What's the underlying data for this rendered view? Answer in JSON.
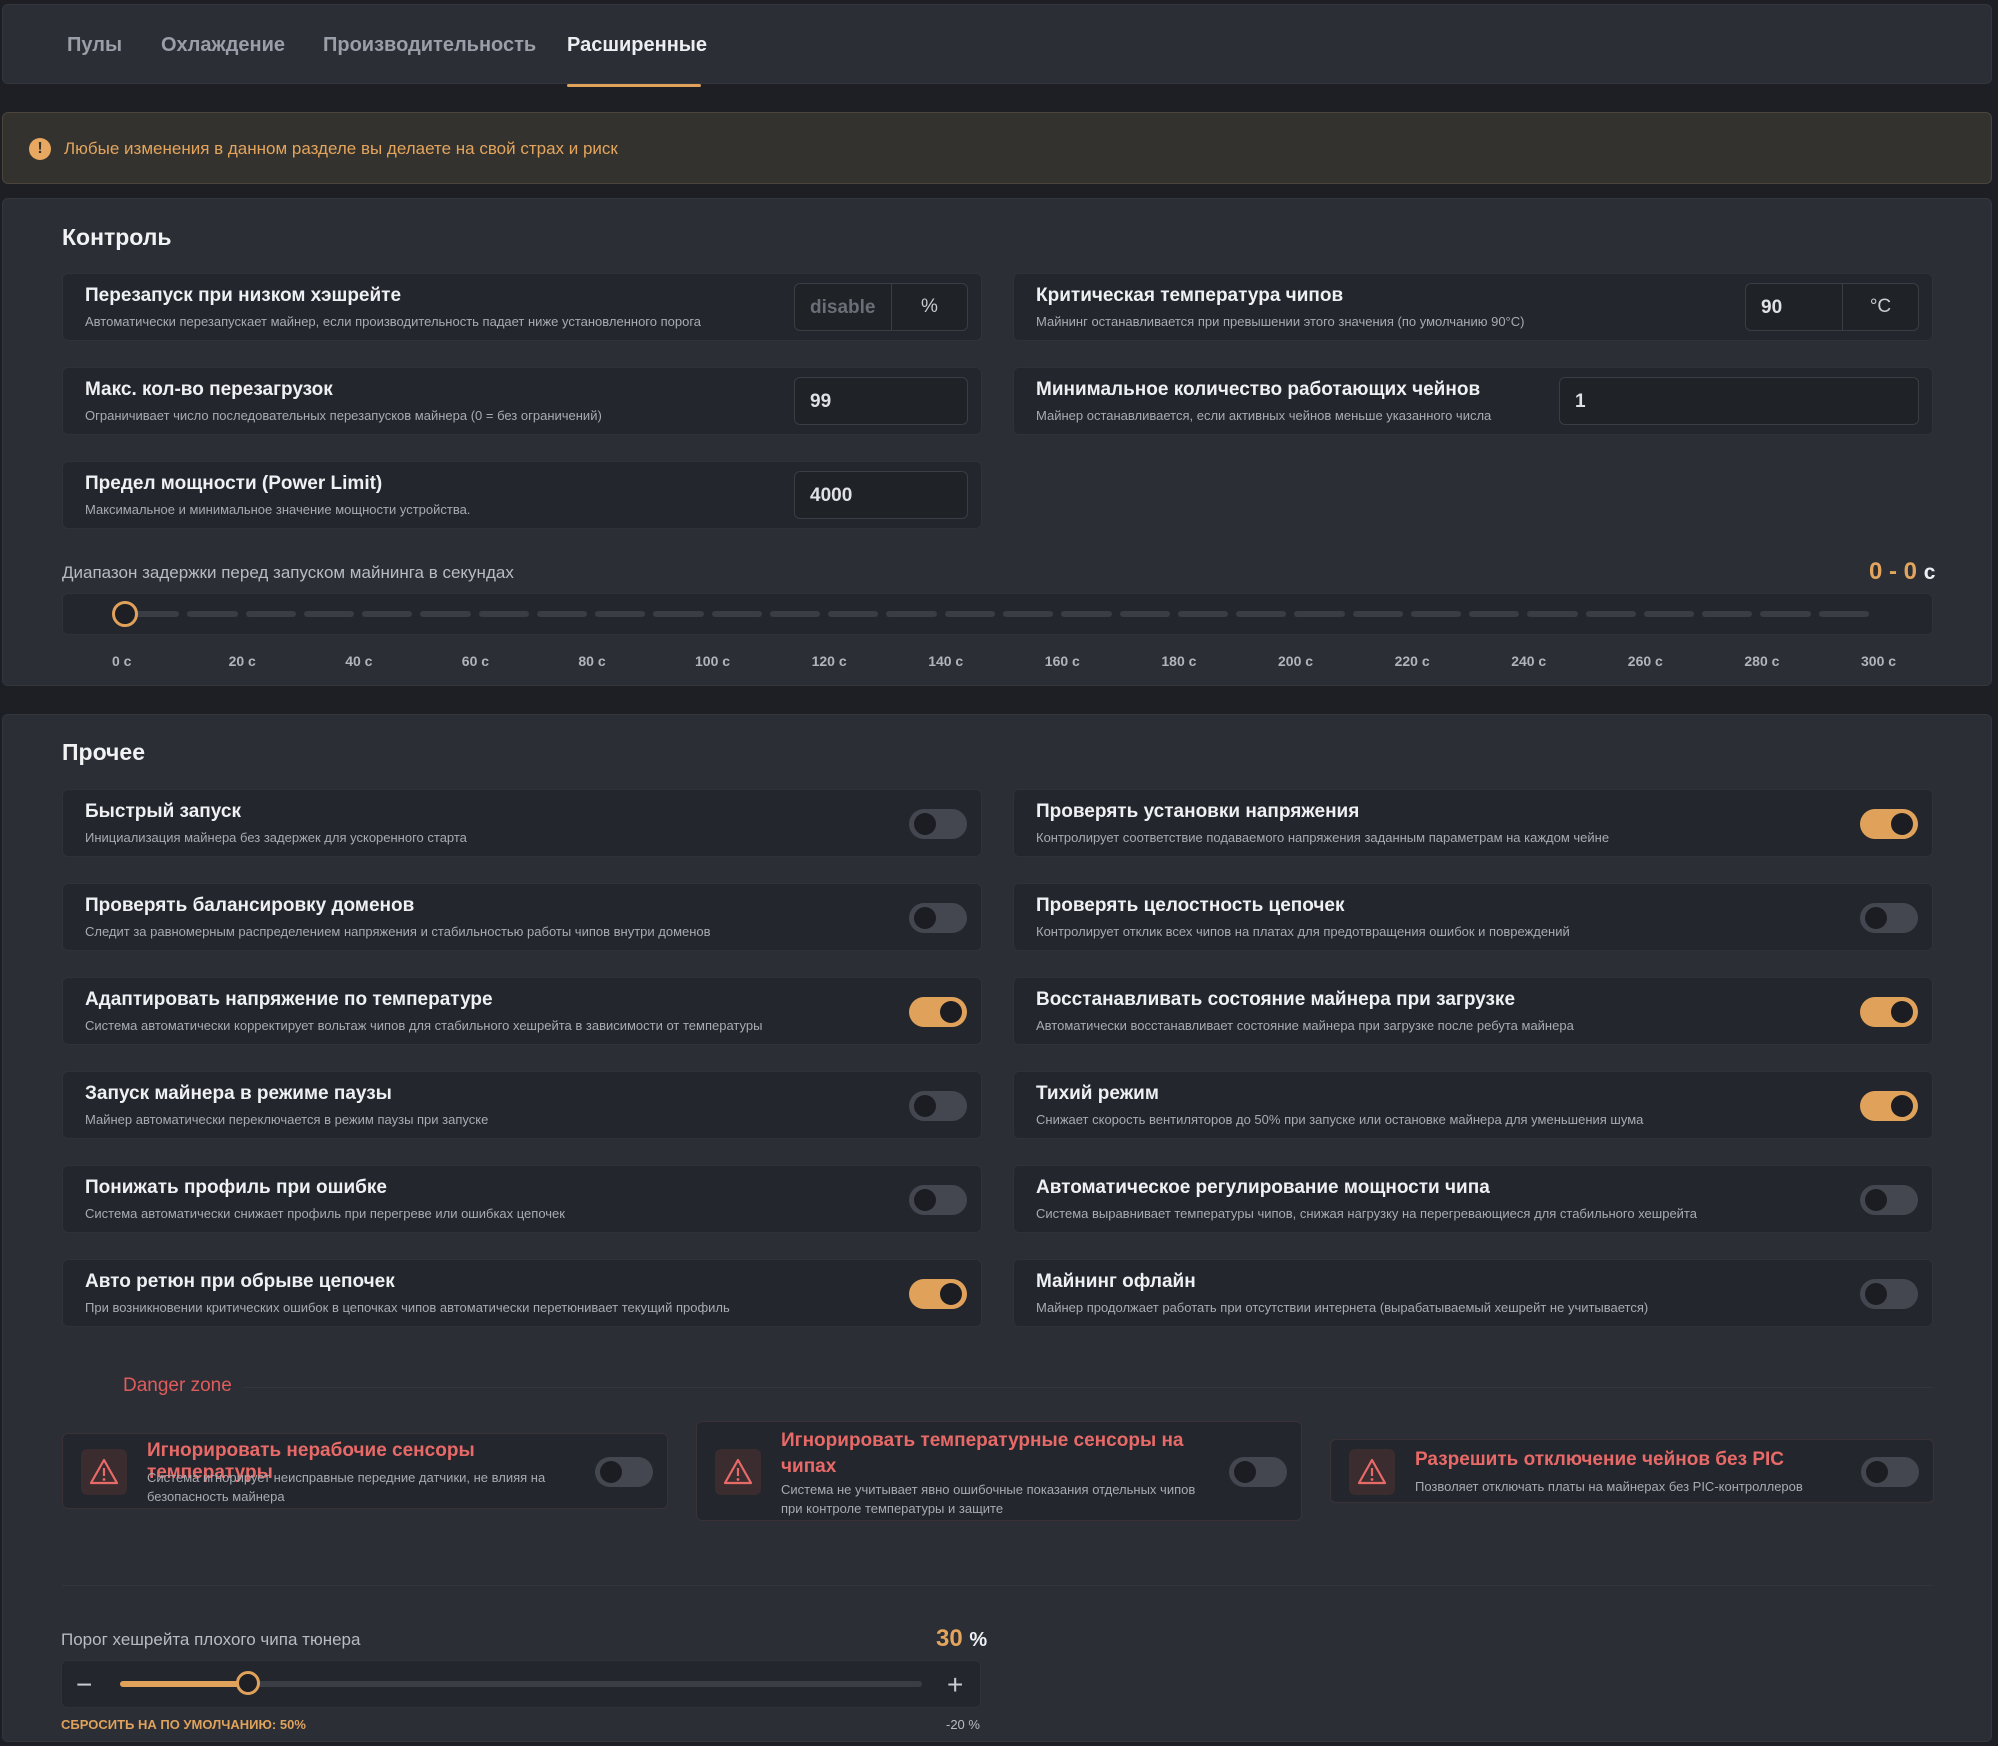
{
  "tabs": [
    "Пулы",
    "Охлаждение",
    "Производительность",
    "Расширенные"
  ],
  "active_tab": "Расширенные",
  "warning": {
    "icon": "exclamation-circle-icon",
    "glyph": "!",
    "text": "Любые изменения в данном разделе вы делаете на свой страх и риск"
  },
  "control": {
    "title": "Контроль",
    "settings": [
      {
        "title": "Перезапуск при низком хэшрейте",
        "desc": "Автоматически перезапускает майнер, если производительность падает ниже установленного порога",
        "value": "disable",
        "unit": "%"
      },
      {
        "title": "Критическая температура чипов",
        "desc": "Майнинг останавливается при превышении этого значения (по умолчанию 90°C)",
        "value": "90",
        "unit": "°C"
      },
      {
        "title": "Макс. кол-во перезагрузок",
        "desc": "Ограничивает число последовательных перезапусков майнера (0 = без ограничений)",
        "value": "99"
      },
      {
        "title": "Минимальное количество работающих чейнов",
        "desc": "Майнер останавливается, если активных чейнов меньше указанного числа",
        "value": "1"
      },
      {
        "title": "Предел мощности (Power Limit)",
        "desc": "Максимальное и минимальное значение мощности устройства.",
        "value": "4000"
      }
    ],
    "delay": {
      "label": "Диапазон задержки перед запуском майнинга в секундах",
      "value": "0 - 0",
      "unit": "с",
      "min": 0,
      "max": 300,
      "range": [
        0,
        0
      ],
      "ticks": [
        "0 с",
        "20 с",
        "40 с",
        "60 с",
        "80 с",
        "100 с",
        "120 с",
        "140 с",
        "160 с",
        "180 с",
        "200 с",
        "220 с",
        "240 с",
        "260 с",
        "280 с",
        "300 с"
      ]
    }
  },
  "other": {
    "title": "Прочее",
    "toggles": [
      {
        "title": "Быстрый запуск",
        "desc": "Инициализация майнера без задержек для ускоренного старта",
        "on": false
      },
      {
        "title": "Проверять установки напряжения",
        "desc": "Контролирует соответствие подаваемого напряжения заданным параметрам на каждом чейне",
        "on": true
      },
      {
        "title": "Проверять балансировку доменов",
        "desc": "Следит за равномерным распределением напряжения и стабильностью работы чипов внутри доменов",
        "on": false
      },
      {
        "title": "Проверять целостность цепочек",
        "desc": "Контролирует отклик всех чипов на платах для предотвращения ошибок и повреждений",
        "on": false
      },
      {
        "title": "Адаптировать напряжение по температуре",
        "desc": "Система автоматически корректирует вольтаж чипов для стабильного хешрейта в зависимости от температуры",
        "on": true
      },
      {
        "title": "Восстанавливать состояние майнера при загрузке",
        "desc": "Автоматически восстанавливает состояние майнера при загрузке после ребута майнера",
        "on": true
      },
      {
        "title": "Запуск майнера в режиме паузы",
        "desc": "Майнер автоматически переключается в режим паузы при запуске",
        "on": false
      },
      {
        "title": "Тихий режим",
        "desc": "Снижает скорость вентиляторов до 50% при запуске или остановке майнера для уменьшения шума",
        "on": true
      },
      {
        "title": "Понижать профиль при ошибке",
        "desc": "Система автоматически снижает профиль при перегреве или ошибках цепочек",
        "on": false
      },
      {
        "title": "Автоматическое регулирование мощности чипа",
        "desc": "Система выравнивает температуры чипов, снижая нагрузку на перегревающиеся для стабильного хешрейта",
        "on": false
      },
      {
        "title": "Авто ретюн при обрыве цепочек",
        "desc": "При возникновении критических ошибок в цепочках чипов автоматически перетюнивает текущий профиль",
        "on": true
      },
      {
        "title": "Майнинг офлайн",
        "desc": "Майнер продолжает работать при отсутствии интернета (вырабатываемый хешрейт не учитывается)",
        "on": false
      }
    ],
    "danger": {
      "title": "Danger zone",
      "icon": "warning-triangle-icon",
      "items": [
        {
          "title": "Игнорировать нерабочие сенсоры температуры",
          "desc": "Система игнорирует неисправные передние датчики, не влияя на безопасность майнера",
          "on": false
        },
        {
          "title": "Игнорировать температурные сенсоры на чипах",
          "desc": "Система не учитывает явно ошибочные показания отдельных чипов при контроле температуры и защите",
          "on": false
        },
        {
          "title": "Разрешить отключение чейнов без PIC",
          "desc": "Позволяет отключать платы на майнерах без PIC-контроллеров",
          "on": false
        }
      ]
    },
    "threshold": {
      "label": "Порог хешрейта плохого чипа тюнера",
      "value": "30",
      "unit": "%",
      "fill_fraction": 0.16,
      "minus": "−",
      "plus": "+",
      "reset": "СБРОСИТЬ НА ПО УМОЛЧАНИЮ: 50%",
      "min_label": "-20 %"
    }
  }
}
